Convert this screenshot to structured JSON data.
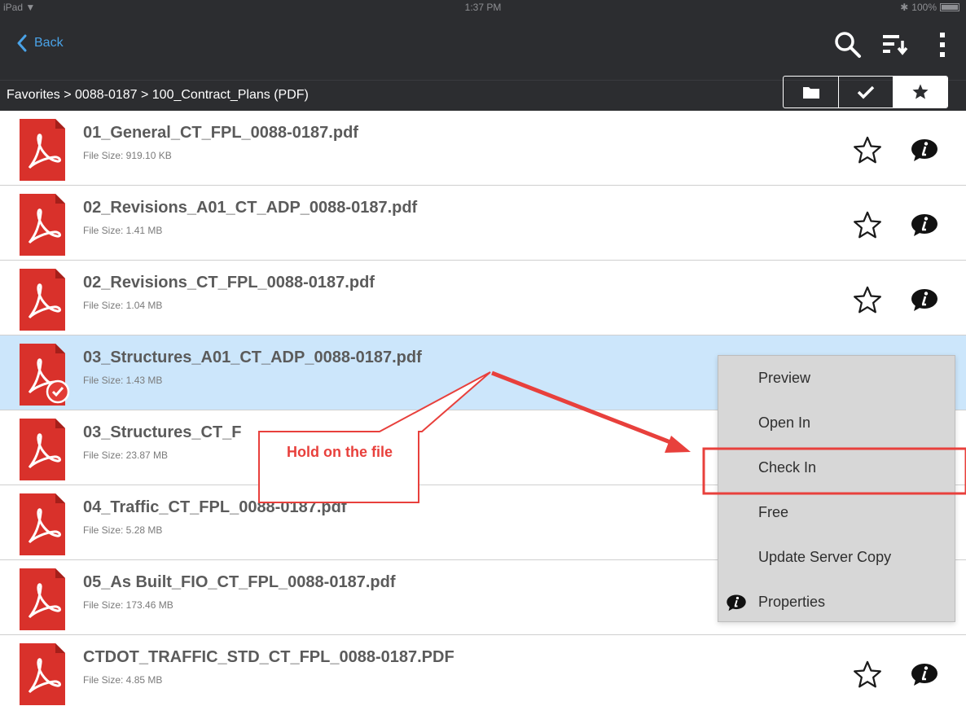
{
  "status_bar": {
    "device": "iPad",
    "time": "1:37 PM",
    "battery": "100%"
  },
  "nav": {
    "back_label": "Back",
    "actions": [
      "search-icon",
      "sort-icon",
      "more-vertical-icon"
    ]
  },
  "breadcrumb": "Favorites > 0088-0187 > 100_Contract_Plans (PDF)",
  "segments": [
    {
      "icon": "folder-icon",
      "active": false
    },
    {
      "icon": "checkmark-icon",
      "active": false
    },
    {
      "icon": "star-icon",
      "active": true
    }
  ],
  "files": [
    {
      "name": "01_General_CT_FPL_0088-0187.pdf",
      "size": "File Size: 919.10 KB"
    },
    {
      "name": "02_Revisions_A01_CT_ADP_0088-0187.pdf",
      "size": "File Size: 1.41 MB"
    },
    {
      "name": "02_Revisions_CT_FPL_0088-0187.pdf",
      "size": "File Size: 1.04 MB"
    },
    {
      "name": "03_Structures_A01_CT_ADP_0088-0187.pdf",
      "size": "File Size: 1.43 MB",
      "selected": true,
      "checked_out": true
    },
    {
      "name": "03_Structures_CT_F",
      "size": "File Size: 23.87 MB"
    },
    {
      "name": "04_Traffic_CT_FPL_0088-0187.pdf",
      "size": "File Size: 5.28 MB"
    },
    {
      "name": "05_As Built_FIO_CT_FPL_0088-0187.pdf",
      "size": "File Size: 173.46 MB"
    },
    {
      "name": "CTDOT_TRAFFIC_STD_CT_FPL_0088-0187.PDF",
      "size": "File Size: 4.85 MB"
    }
  ],
  "context_menu": {
    "items": [
      {
        "label": "Preview"
      },
      {
        "label": "Open In"
      },
      {
        "label": "Check In",
        "highlighted": true
      },
      {
        "label": "Free"
      },
      {
        "label": "Update Server Copy"
      },
      {
        "label": "Properties",
        "icon": "info-icon"
      }
    ]
  },
  "annotation": {
    "callout_text": "Hold on the file",
    "color": "#e8403c"
  },
  "colors": {
    "bar_bg": "#2c2d30",
    "accent": "#4aa3e8",
    "selected_row": "#cce6fb",
    "pdf_red": "#d9312b"
  }
}
